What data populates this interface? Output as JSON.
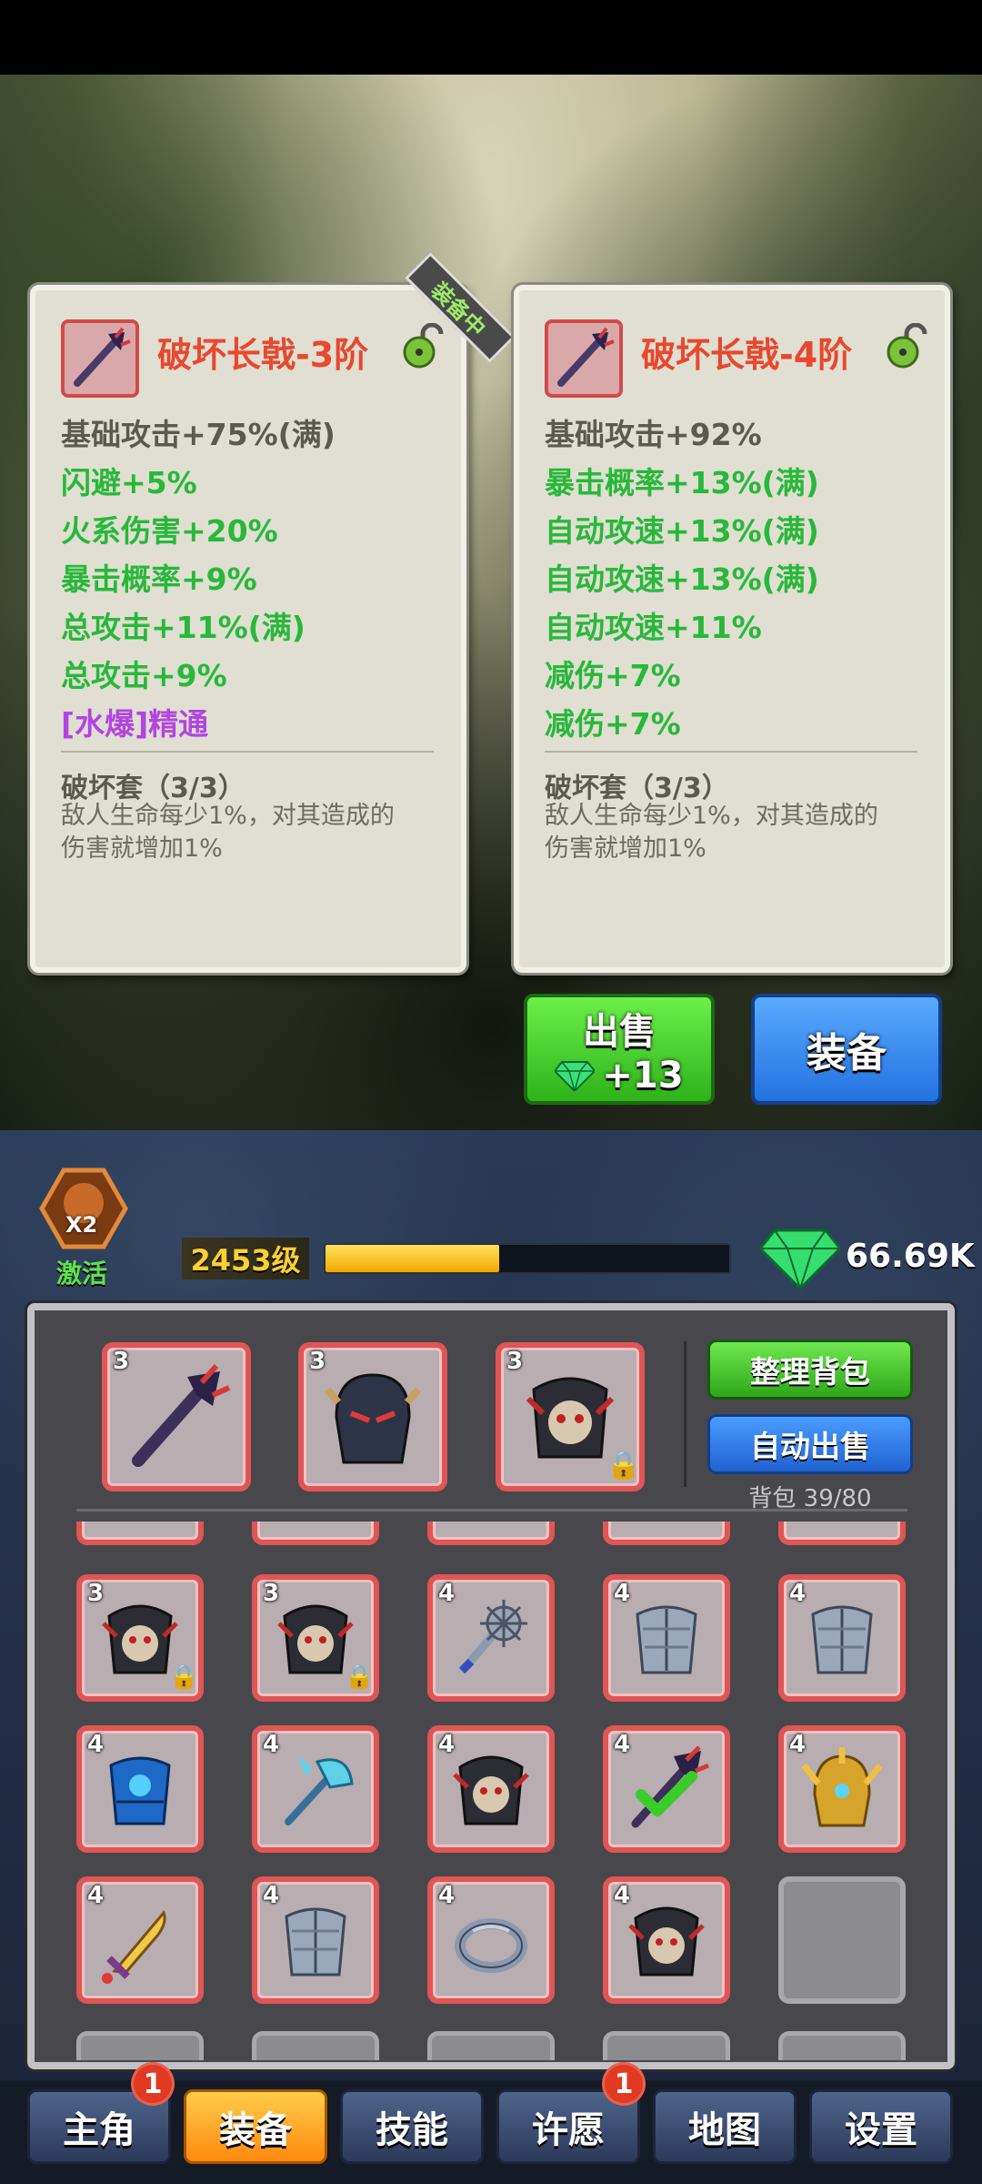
{
  "compare": {
    "equipped_tag": "装备中",
    "left": {
      "name": "破坏长戟-3阶",
      "stats": [
        {
          "text": "基础攻击+75%(满)",
          "color": "gray"
        },
        {
          "text": "闪避+5%",
          "color": "green"
        },
        {
          "text": "火系伤害+20%",
          "color": "green"
        },
        {
          "text": "暴击概率+9%",
          "color": "green"
        },
        {
          "text": "总攻击+11%(满)",
          "color": "green"
        },
        {
          "text": "总攻击+9%",
          "color": "green"
        },
        {
          "text": "[水爆]精通",
          "color": "purple"
        }
      ],
      "set_name": "破坏套（3/3）",
      "set_desc_1": "敌人生命每少1%，对其造成的",
      "set_desc_2": "伤害就增加1%"
    },
    "right": {
      "name": "破坏长戟-4阶",
      "stats": [
        {
          "text": "基础攻击+92%",
          "color": "gray"
        },
        {
          "text": "暴击概率+13%(满)",
          "color": "green"
        },
        {
          "text": "自动攻速+13%(满)",
          "color": "green"
        },
        {
          "text": "自动攻速+13%(满)",
          "color": "green"
        },
        {
          "text": "自动攻速+11%",
          "color": "green"
        },
        {
          "text": "减伤+7%",
          "color": "green"
        },
        {
          "text": "减伤+7%",
          "color": "green"
        }
      ],
      "set_name": "破坏套（3/3）",
      "set_desc_1": "敌人生命每少1%，对其造成的",
      "set_desc_2": "伤害就增加1%"
    }
  },
  "actions": {
    "sell_label": "出售",
    "sell_reward": "+13",
    "equip_label": "装备"
  },
  "status": {
    "boost_multiplier": "X2",
    "activate_label": "激活",
    "level": "2453级",
    "level_progress": 0.43,
    "gems": "66.69K"
  },
  "bag": {
    "sort_label": "整理背包",
    "auto_sell_label": "自动出售",
    "capacity": "背包 39/80",
    "equipped": [
      {
        "tier": "3",
        "icon": "halberd-icon",
        "locked": false
      },
      {
        "tier": "3",
        "icon": "helmet-icon",
        "locked": false
      },
      {
        "tier": "3",
        "icon": "skull-armor-icon",
        "locked": true
      }
    ],
    "rows": [
      [
        {
          "tier": "3",
          "icon": "skull-armor-icon",
          "locked": true
        },
        {
          "tier": "3",
          "icon": "skull-armor-icon",
          "locked": true
        },
        {
          "tier": "4",
          "icon": "mace-icon",
          "locked": false
        },
        {
          "tier": "4",
          "icon": "steel-armor-icon",
          "locked": false
        },
        {
          "tier": "4",
          "icon": "steel-armor-icon",
          "locked": false
        }
      ],
      [
        {
          "tier": "4",
          "icon": "blue-armor-icon",
          "locked": false
        },
        {
          "tier": "4",
          "icon": "ice-axe-icon",
          "locked": false
        },
        {
          "tier": "4",
          "icon": "skull-armor-icon",
          "locked": false
        },
        {
          "tier": "4",
          "icon": "halberd-check-icon",
          "locked": false
        },
        {
          "tier": "4",
          "icon": "gold-helmet-icon",
          "locked": false
        }
      ],
      [
        {
          "tier": "4",
          "icon": "golden-sword-icon",
          "locked": false
        },
        {
          "tier": "4",
          "icon": "steel-armor-icon",
          "locked": false
        },
        {
          "tier": "4",
          "icon": "ring-icon",
          "locked": false
        },
        {
          "tier": "4",
          "icon": "skull-armor-icon",
          "locked": false
        },
        {
          "tier": "",
          "icon": "empty-slot",
          "locked": false
        }
      ]
    ]
  },
  "nav": {
    "tabs": [
      "主角",
      "装备",
      "技能",
      "许愿",
      "地图",
      "设置"
    ],
    "active": "装备",
    "badge_hero": "1",
    "badge_wish": "1"
  },
  "colors": {
    "title_red": "#e8482e",
    "stat_green": "#28b83a",
    "stat_purple": "#b244e0",
    "sell_green": "#3fcf2a",
    "equip_blue": "#2e86f0",
    "xp_yellow": "#ffc515"
  }
}
